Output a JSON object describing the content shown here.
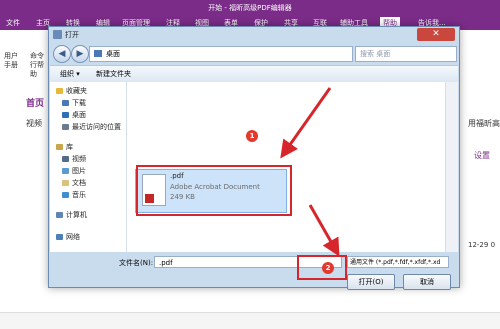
{
  "app": {
    "title": "开始 - 福昕高级PDF编辑器",
    "menu": [
      "文件",
      "主页",
      "转换",
      "编辑",
      "页面管理",
      "注释",
      "视图",
      "表单",
      "保护",
      "共享",
      "互联",
      "辅助工具",
      "帮助"
    ],
    "active_menu": "帮助",
    "search_placeholder": "告诉我...",
    "ribbon": {
      "btn1": "用户手册",
      "btn2": "命令行帮助"
    },
    "left": {
      "home": "首页",
      "video": "视频"
    },
    "content": {
      "right_text": "用福昕高",
      "settings": "设置",
      "date": "12-29 0"
    }
  },
  "dialog": {
    "title": "打开",
    "address": "桌面",
    "search_placeholder": "搜索 桌面",
    "toolbar": {
      "organize": "组织 ▾",
      "new_folder": "新建文件夹"
    },
    "nav": {
      "favorites_header": "收藏夹",
      "favorites": [
        "下载",
        "桌面",
        "最近访问的位置"
      ],
      "library_header": "库",
      "library": [
        "视频",
        "图片",
        "文档",
        "音乐"
      ],
      "computer": "计算机",
      "network": "网络"
    },
    "file": {
      "name": ".pdf",
      "type": "Adobe Acrobat Document",
      "size": "249 KB"
    },
    "bottom": {
      "filename_label": "文件名(N):",
      "filename_value": ".pdf",
      "filetype_value": "通用文件 (*.pdf,*.fdf,*.xfdf,*.xd",
      "open_button": "打开(O)",
      "cancel_button": "取消"
    },
    "badges": {
      "one": "1",
      "two": "2"
    }
  },
  "colors": {
    "brand": "#7b2c88",
    "annotation": "#d7262b"
  }
}
